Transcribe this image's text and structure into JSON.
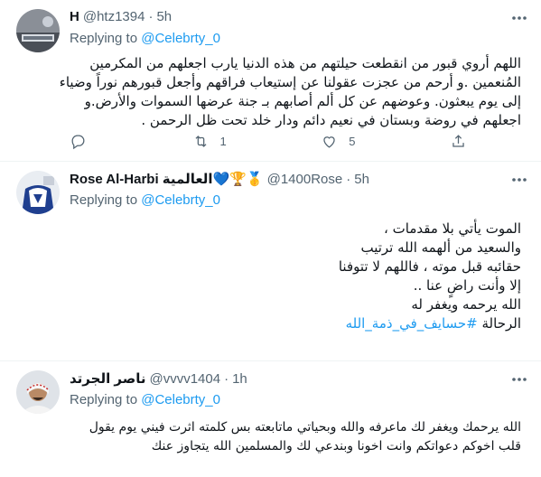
{
  "reply_prefix": "Replying to",
  "tweets": [
    {
      "name": "H",
      "handle": "@htz1394",
      "dot": "·",
      "time": "5h",
      "mention": "@Celebrty_0",
      "lines": [
        "اللهم أروي قبور من انقطعت حيلتهم من هذه الدنيا يارب اجعلهم من المكرمين",
        "المُنعمين .و أرحم من عجزت عقولنا عن إستيعاب فراقهم وأجعل قبورهم نوراً وضياء",
        "إلى يوم يبعثون. وعوضهم عن كل ألم أصابهم بـ جنة عرضها السموات والأرض.و",
        "اجعلهم في روضة وبستان في نعيم دائم ودار خلد تحت ظل الرحمن ."
      ],
      "replies": "",
      "retweets": "1",
      "likes": "5"
    },
    {
      "name": "Rose Al-Harbi العالمية💙🏆🥇",
      "handle": "@1400Rose",
      "dot": "·",
      "time": "5h",
      "mention": "@Celebrty_0",
      "lines": [
        "الموت يأتي بلا مقدمات ،",
        "والسعيد من ألهمه الله ترتيب",
        "حقائبه قبل موته ، فاللهم لا تتوفنا",
        "إلا وأنت راضٍ عنا ..",
        "الله يرحمه ويغفر له",
        "الرحالة"
      ],
      "hashtag": "#حسايف_في_ذمة_الله"
    },
    {
      "name": "ناصر الجرتد",
      "handle": "@vvvv1404",
      "dot": "·",
      "time": "1h",
      "mention": "@Celebrty_0",
      "lines": [
        "الله يرحمك ويغفر لك ماعرفه والله وبحياتي ماتابعته بس كلمته اثرت فيني يوم يقول",
        "قلب اخوكم دعواتكم وانت اخونا وبندعي لك والمسلمين الله يتجاوز عنك"
      ]
    }
  ],
  "icons": {
    "more": "more-horizontal-icon",
    "reply": "reply-icon",
    "retweet": "retweet-icon",
    "like": "heart-icon",
    "share": "share-icon"
  }
}
